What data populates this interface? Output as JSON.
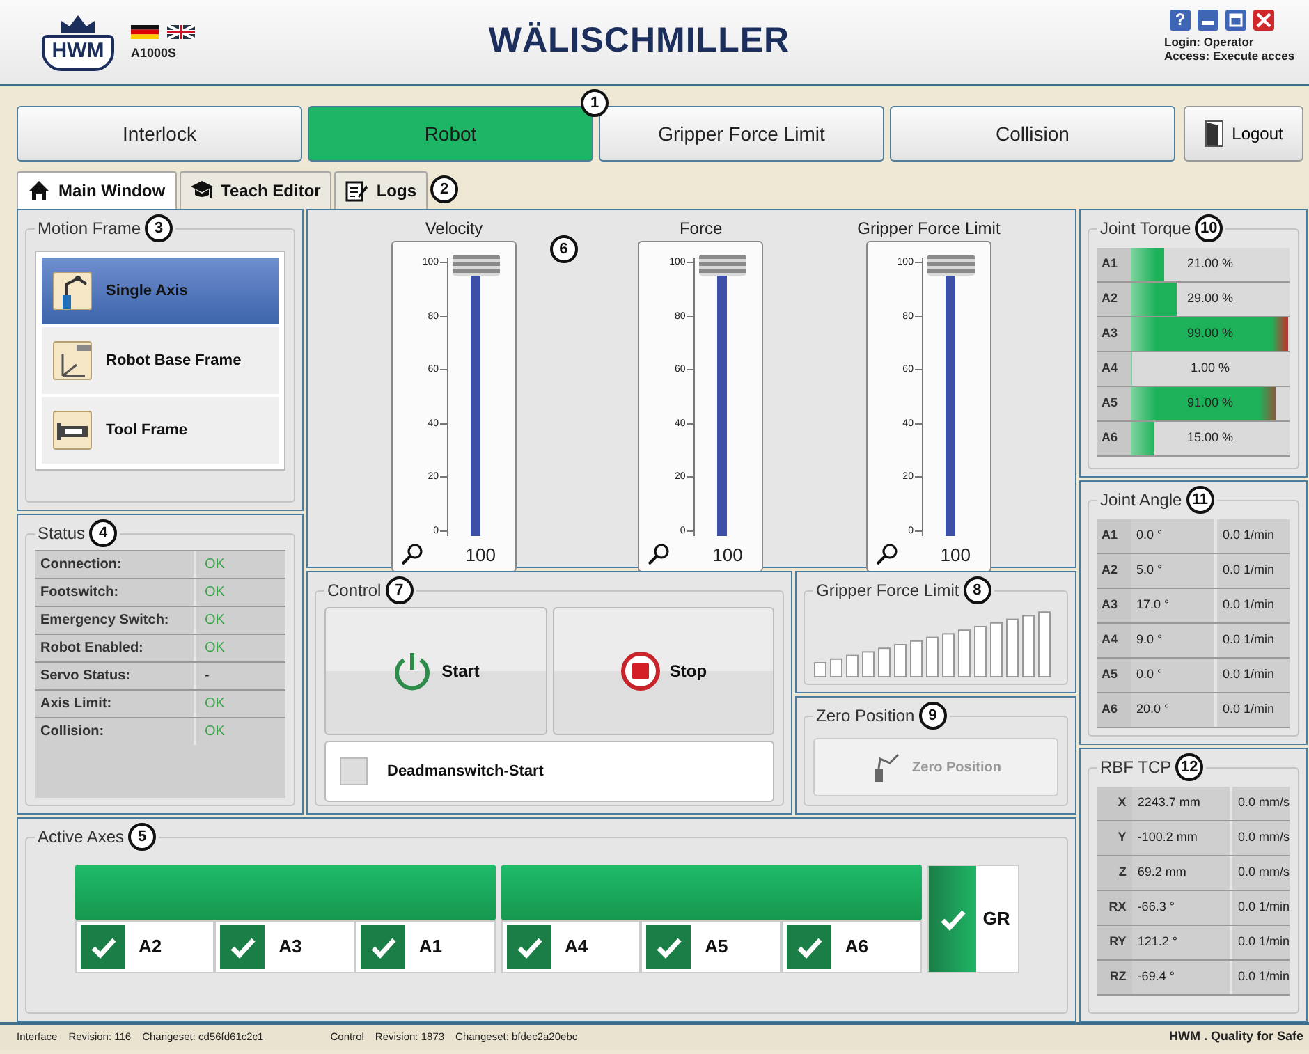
{
  "header": {
    "logo": "HWM",
    "model": "A1000S",
    "brand": "WÄLISCHMILLER",
    "help": "?",
    "login": "Login: Operator",
    "access": "Access: Execute acces"
  },
  "modules": [
    {
      "label": "Interlock",
      "selected": false
    },
    {
      "label": "Robot",
      "selected": true
    },
    {
      "label": "Gripper Force Limit",
      "selected": false
    },
    {
      "label": "Collision",
      "selected": false
    }
  ],
  "modules_callout": "1",
  "logout": "Logout",
  "tabs": [
    {
      "label": "Main Window",
      "selected": true
    },
    {
      "label": "Teach Editor",
      "selected": false
    },
    {
      "label": "Logs",
      "selected": false
    }
  ],
  "tabs_callout": "2",
  "motion_frame": {
    "title": "Motion Frame",
    "callout": "3",
    "items": [
      {
        "label": "Single Axis",
        "selected": true
      },
      {
        "label": "Robot Base Frame",
        "selected": false
      },
      {
        "label": "Tool Frame",
        "selected": false
      }
    ]
  },
  "status": {
    "title": "Status",
    "callout": "4",
    "rows": [
      {
        "label": "Connection:",
        "value": "OK",
        "ok": true
      },
      {
        "label": "Footswitch:",
        "value": "OK",
        "ok": true
      },
      {
        "label": "Emergency Switch:",
        "value": "OK",
        "ok": true
      },
      {
        "label": "Robot Enabled:",
        "value": "OK",
        "ok": true
      },
      {
        "label": "Servo Status:",
        "value": "-",
        "ok": false
      },
      {
        "label": "Axis Limit:",
        "value": "OK",
        "ok": true
      },
      {
        "label": "Collision:",
        "value": "OK",
        "ok": true
      }
    ]
  },
  "sliders": {
    "callout": "6",
    "items": [
      {
        "title": "Velocity",
        "level": 1.0,
        "value": "100",
        "ticks": [
          "100",
          "80",
          "60",
          "40",
          "20",
          "0"
        ]
      },
      {
        "title": "Force",
        "level": 1.0,
        "value": "100",
        "ticks": [
          "100",
          "80",
          "60",
          "40",
          "20",
          "0"
        ]
      },
      {
        "title": "Gripper Force Limit",
        "level": 1.0,
        "value": "100",
        "ticks": [
          "100",
          "80",
          "60",
          "40",
          "20",
          "0"
        ]
      }
    ]
  },
  "control": {
    "title": "Control",
    "callout": "7",
    "start": "Start",
    "stop": "Stop",
    "deadman": {
      "label": "Deadmanswitch-Start",
      "checked": false
    }
  },
  "gripper_force_limit": {
    "title": "Gripper Force Limit",
    "callout": "8"
  },
  "zero_position": {
    "title": "Zero Position",
    "callout": "9",
    "button": "Zero Position",
    "disabled": true
  },
  "active_axes": {
    "title": "Active Axes",
    "callout": "5",
    "groups": [
      {
        "axes": [
          {
            "label": "A2",
            "checked": true
          },
          {
            "label": "A3",
            "checked": true
          },
          {
            "label": "A1",
            "checked": true
          }
        ]
      },
      {
        "axes": [
          {
            "label": "A4",
            "checked": true
          },
          {
            "label": "A5",
            "checked": true
          },
          {
            "label": "A6",
            "checked": true
          }
        ]
      }
    ],
    "gripper": {
      "label": "GR",
      "checked": true
    }
  },
  "joint_torque": {
    "title": "Joint Torque",
    "callout": "10",
    "rows": [
      {
        "axis": "A1",
        "reading": "21.00 %",
        "level": 0.21
      },
      {
        "axis": "A2",
        "reading": "29.00 %",
        "level": 0.29
      },
      {
        "axis": "A3",
        "reading": "99.00 %",
        "level": 0.99
      },
      {
        "axis": "A4",
        "reading": "1.00 %",
        "level": 0.01
      },
      {
        "axis": "A5",
        "reading": "91.00 %",
        "level": 0.91
      },
      {
        "axis": "A6",
        "reading": "15.00 %",
        "level": 0.15
      }
    ]
  },
  "joint_angle": {
    "title": "Joint Angle",
    "callout": "11",
    "rows": [
      {
        "axis": "A1",
        "angle": "0.0 °",
        "speed": "0.0 1/min"
      },
      {
        "axis": "A2",
        "angle": "5.0 °",
        "speed": "0.0 1/min"
      },
      {
        "axis": "A3",
        "angle": "17.0 °",
        "speed": "0.0 1/min"
      },
      {
        "axis": "A4",
        "angle": "9.0 °",
        "speed": "0.0 1/min"
      },
      {
        "axis": "A5",
        "angle": "0.0 °",
        "speed": "0.0 1/min"
      },
      {
        "axis": "A6",
        "angle": "20.0 °",
        "speed": "0.0 1/min"
      }
    ]
  },
  "rbf_tcp": {
    "title": "RBF TCP",
    "callout": "12",
    "rows": [
      {
        "axis": "X",
        "position": "2243.7 mm",
        "speed": "0.0 mm/s"
      },
      {
        "axis": "Y",
        "position": "-100.2 mm",
        "speed": "0.0 mm/s"
      },
      {
        "axis": "Z",
        "position": "69.2 mm",
        "speed": "0.0 mm/s"
      },
      {
        "axis": "RX",
        "position": "-66.3 °",
        "speed": "0.0 1/min"
      },
      {
        "axis": "RY",
        "position": "121.2 °",
        "speed": "0.0 1/min"
      },
      {
        "axis": "RZ",
        "position": "-69.4 °",
        "speed": "0.0 1/min"
      }
    ]
  },
  "status_bar": {
    "interface": "Interface",
    "interface_revision": "Revision: 116",
    "interface_changeset": "Changeset: cd56fd61c2c1",
    "control": "Control",
    "control_revision": "Revision: 1873",
    "control_changeset": "Changeset: bfdec2a20ebc",
    "slogan": "HWM . Quality for Safe"
  }
}
